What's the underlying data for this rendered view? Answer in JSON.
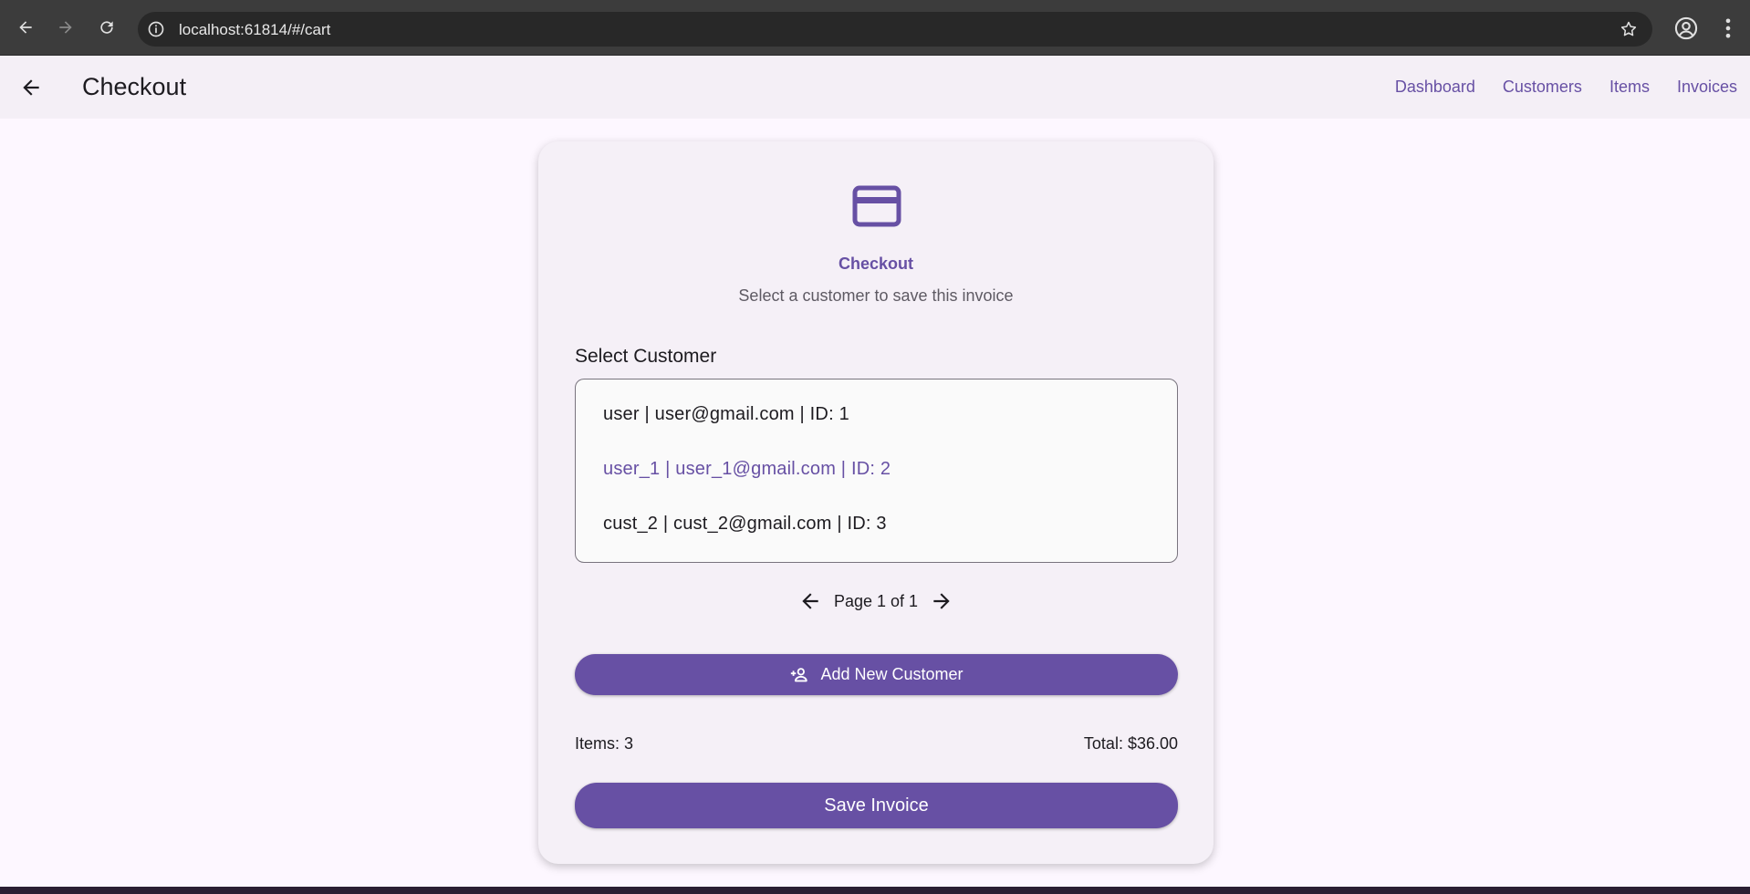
{
  "browser": {
    "url": "localhost:61814/#/cart"
  },
  "app_bar": {
    "title": "Checkout",
    "nav": [
      {
        "label": "Dashboard"
      },
      {
        "label": "Customers"
      },
      {
        "label": "Items"
      },
      {
        "label": "Invoices"
      }
    ]
  },
  "card": {
    "icon": "credit-card-icon",
    "title": "Checkout",
    "subtitle": "Select a customer to save this invoice",
    "section_label": "Select Customer",
    "customers": [
      {
        "label": "user | user@gmail.com | ID: 1",
        "selected": false
      },
      {
        "label": "user_1 | user_1@gmail.com | ID: 2",
        "selected": true
      },
      {
        "label": "cust_2 | cust_2@gmail.com | ID: 3",
        "selected": false
      }
    ],
    "pager": {
      "text": "Page 1 of 1"
    },
    "add_customer_label": "Add New Customer",
    "items_label": "Items: 3",
    "total_label": "Total: $36.00",
    "save_label": "Save Invoice"
  },
  "colors": {
    "accent": "#6750a4",
    "background": "#fdf7ff",
    "card": "#f5f0f7"
  }
}
